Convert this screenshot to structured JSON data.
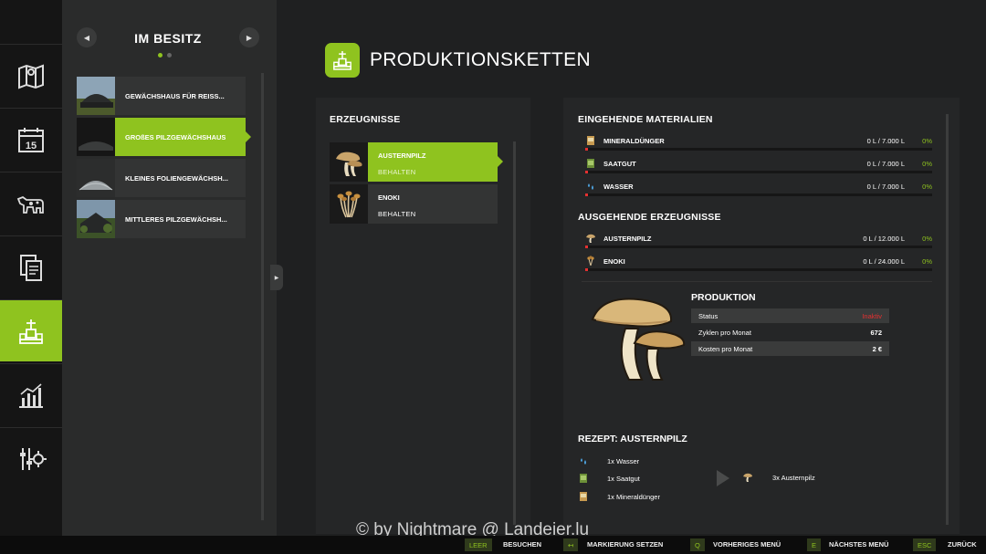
{
  "owned": {
    "title": "IM BESITZ",
    "items": [
      {
        "label": "GEWÄCHSHAUS FÜR REISS..."
      },
      {
        "label": "GROßES PILZGEWÄCHSHAUS"
      },
      {
        "label": "KLEINES FOLIENGEWÄCHSH..."
      },
      {
        "label": "MITTLERES PILZGEWÄCHSH..."
      }
    ]
  },
  "header": {
    "title": "PRODUKTIONSKETTEN"
  },
  "products": {
    "title": "ERZEUGNISSE",
    "items": [
      {
        "name": "AUSTERNPILZ",
        "status": "BEHALTEN"
      },
      {
        "name": "ENOKI",
        "status": "BEHALTEN"
      }
    ]
  },
  "incoming": {
    "title": "EINGEHENDE MATERIALIEN",
    "items": [
      {
        "name": "MINERALDÜNGER",
        "amount": "0 L / 7.000 L",
        "percent": "0%"
      },
      {
        "name": "SAATGUT",
        "amount": "0 L / 7.000 L",
        "percent": "0%"
      },
      {
        "name": "WASSER",
        "amount": "0 L / 7.000 L",
        "percent": "0%"
      }
    ]
  },
  "outgoing": {
    "title": "AUSGEHENDE ERZEUGNISSE",
    "items": [
      {
        "name": "AUSTERNPILZ",
        "amount": "0 L / 12.000 L",
        "percent": "0%"
      },
      {
        "name": "ENOKI",
        "amount": "0 L / 24.000 L",
        "percent": "0%"
      }
    ]
  },
  "production": {
    "title": "PRODUKTION",
    "rows": [
      {
        "label": "Status",
        "value": "Inaktiv"
      },
      {
        "label": "Zyklen pro Monat",
        "value": "672"
      },
      {
        "label": "Kosten pro Monat",
        "value": "2 €"
      }
    ]
  },
  "recipe": {
    "title": "REZEPT: AUSTERNPILZ",
    "inputs": [
      "1x Wasser",
      "1x Saatgut",
      "1x Mineraldünger"
    ],
    "output": "3x Austernpilz"
  },
  "footer": {
    "actions": [
      {
        "key": "LEER",
        "label": "BESUCHEN"
      },
      {
        "key": "↤",
        "label": "MARKIERUNG SETZEN"
      },
      {
        "key": "Q",
        "label": "VORHERIGES MENÜ"
      },
      {
        "key": "E",
        "label": "NÄCHSTES MENÜ"
      },
      {
        "key": "ESC",
        "label": "ZURÜCK"
      }
    ]
  },
  "watermark": "© by Nightmare @ Landeier.lu",
  "colors": {
    "accent": "#8fc31f",
    "inactive": "#e53030",
    "panel": "#252627"
  }
}
